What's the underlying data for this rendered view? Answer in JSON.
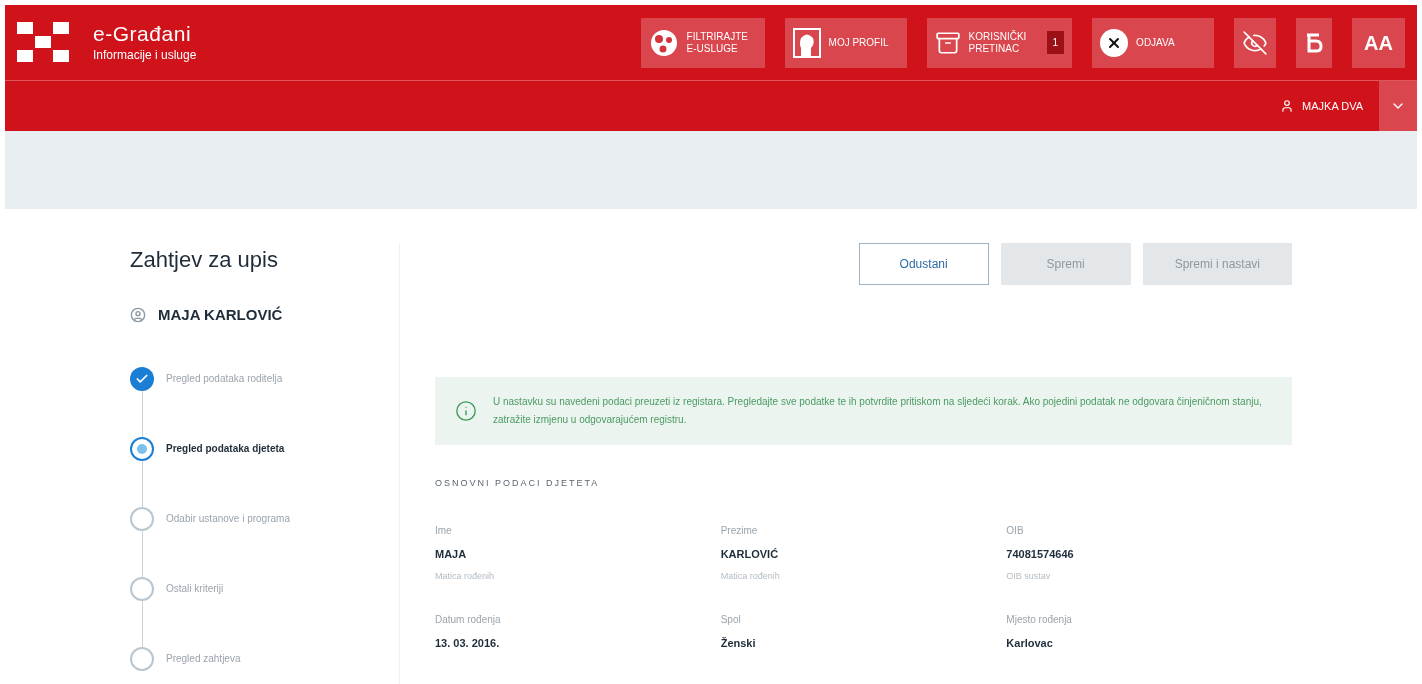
{
  "header": {
    "brand": "e-Građani",
    "tagline": "Informacije i usluge",
    "actions": [
      {
        "kind": "filter",
        "label": "FILTRIRAJTE E-USLUGE"
      },
      {
        "kind": "profile",
        "label": "MOJ PROFIL"
      },
      {
        "kind": "inbox",
        "label": "KORISNIČKI PRETINAC",
        "badge": "1"
      },
      {
        "kind": "logout",
        "label": "ODJAVA"
      },
      {
        "kind": "visibility"
      },
      {
        "kind": "font"
      },
      {
        "kind": "textsize",
        "label": "AA"
      }
    ],
    "user": "MAJKA DVA"
  },
  "page": {
    "title": "Zahtjev za upis",
    "person": "MAJA KARLOVIĆ",
    "buttons": [
      {
        "label": "Odustani",
        "disabled": false
      },
      {
        "label": "Spremi",
        "disabled": true
      },
      {
        "label": "Spremi i nastavi",
        "disabled": true
      }
    ],
    "steps": [
      {
        "label": "Pregled podataka roditelja",
        "completed": true,
        "selected": false
      },
      {
        "label": "Pregled podataka djeteta",
        "completed": false,
        "selected": true
      },
      {
        "label": "Odabir ustanove i programa",
        "completed": false,
        "selected": false
      },
      {
        "label": "Ostali kriteriji",
        "completed": false,
        "selected": false
      },
      {
        "label": "Pregled zahtjeva",
        "completed": false,
        "selected": false
      }
    ],
    "notice": "U nastavku su navedeni podaci preuzeti iz registara. Pregledajte sve podatke te ih potvrdite pritiskom na sljedeći korak. Ako pojedini podatak ne odgovara činjeničnom stanju, zatražite izmjenu u odgovarajućem registru.",
    "section": "OSNOVNI PODACI DJETETA",
    "fields": [
      {
        "label": "Ime",
        "value": "MAJA",
        "source": "Matica rođenih"
      },
      {
        "label": "Prezime",
        "value": "KARLOVIĆ",
        "source": "Matica rođenih"
      },
      {
        "label": "OIB",
        "value": "74081574646",
        "source": "OIB sustav"
      },
      {
        "label": "Datum rođenja",
        "value": "13. 03. 2016."
      },
      {
        "label": "Spol",
        "value": "Ženski"
      },
      {
        "label": "Mjesto rođenja",
        "value": "Karlovac"
      }
    ]
  }
}
